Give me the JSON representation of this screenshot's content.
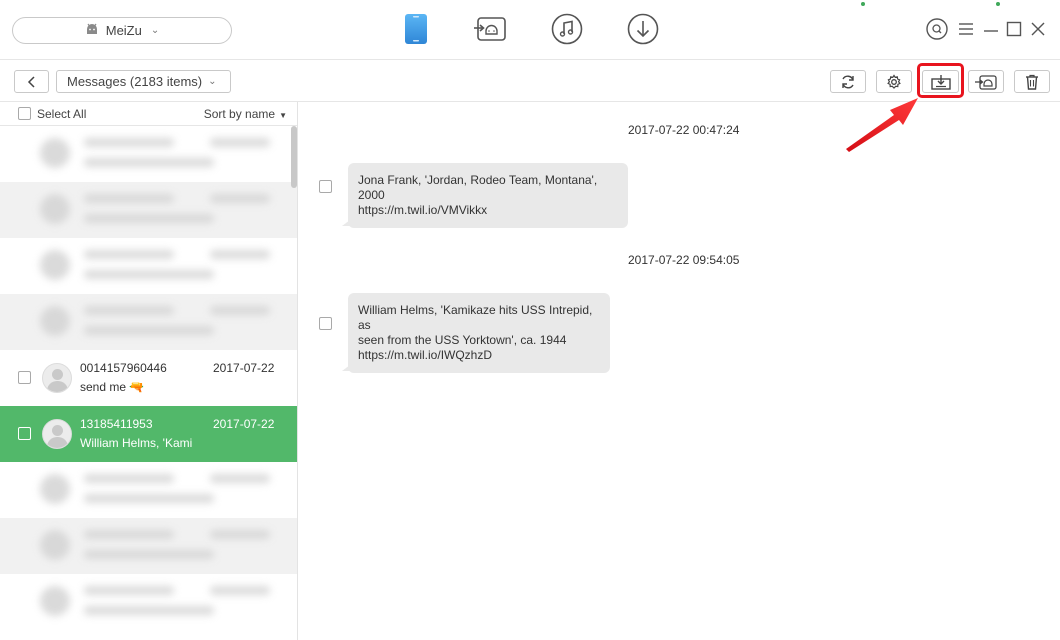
{
  "topbar": {
    "device_name": "MeiZu",
    "nav_icons": [
      "phone-icon",
      "android-transfer-icon",
      "music-icon",
      "download-icon"
    ],
    "accent_color": "#3b97e3"
  },
  "toolbar": {
    "category": "Messages (2183 items)",
    "tool_icons": [
      "refresh-icon",
      "settings-icon",
      "export-to-pc-icon",
      "export-to-device-icon",
      "trash-icon"
    ],
    "highlight_color": "#e8141e"
  },
  "list": {
    "select_all": "Select All",
    "sort": "Sort by name",
    "items": [
      {
        "number": "0014157960446",
        "date": "2017-07-22",
        "preview": "send me 🔫"
      },
      {
        "number": "13185411953",
        "date": "2017-07-22",
        "preview": "William Helms, 'Kami"
      }
    ],
    "selected_color": "#52b86a"
  },
  "conversation": {
    "messages": [
      {
        "time": "2017-07-22 00:47:24",
        "line1": "Jona Frank, 'Jordan, Rodeo Team, Montana', 2000",
        "line2": "https://m.twil.io/VMVikkx",
        "line3": ""
      },
      {
        "time": "2017-07-22 09:54:05",
        "line1": "William Helms, 'Kamikaze hits USS Intrepid, as",
        "line2": "seen from the USS Yorktown', ca. 1944",
        "line3": "https://m.twil.io/IWQzhzD"
      }
    ]
  }
}
